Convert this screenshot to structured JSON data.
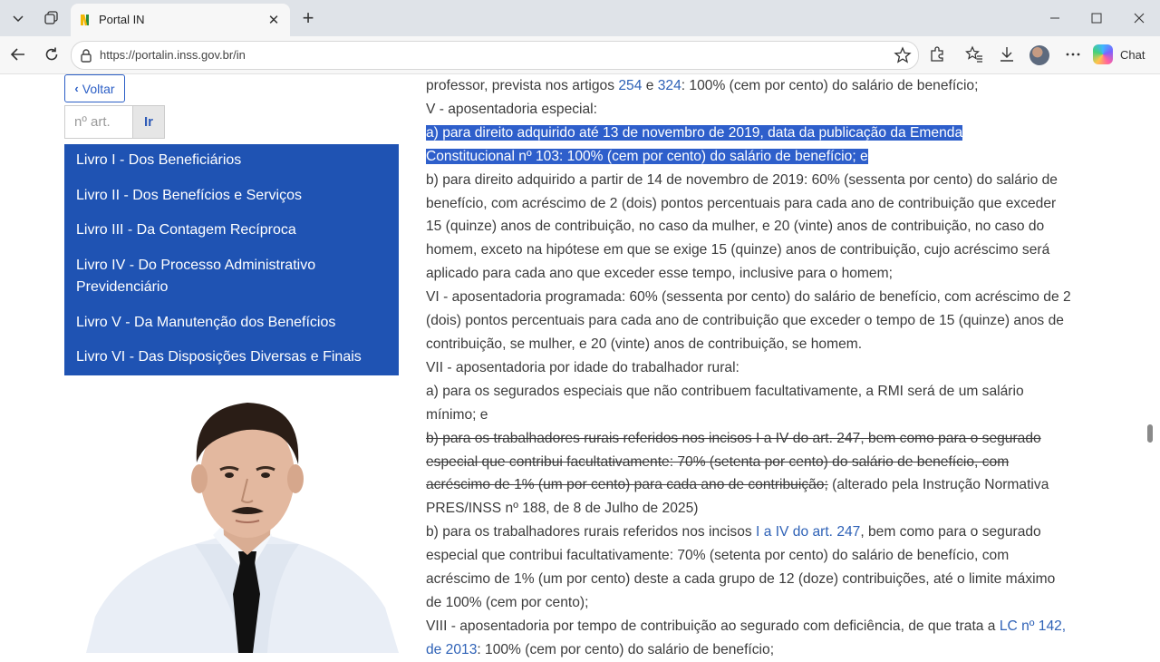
{
  "browser": {
    "tab_title": "Portal IN",
    "tab_close": "✕",
    "new_tab": "+",
    "url": "https://portalin.inss.gov.br/in",
    "chat_label": "Chat"
  },
  "sidebar": {
    "back_label": "Voltar",
    "article_placeholder": "nº art.",
    "go_label": "Ir",
    "books": [
      "Livro I - Dos Beneficiários",
      "Livro II - Dos Benefícios e Serviços",
      "Livro III - Da Contagem Recíproca",
      "Livro IV - Do Processo Administrativo Previdenciário",
      "Livro V - Da Manutenção dos Benefícios",
      "Livro VI - Das Disposições Diversas e Finais"
    ]
  },
  "content": {
    "p1_a": "professor, prevista nos artigos ",
    "p1_link1": "254",
    "p1_b": " e ",
    "p1_link2": "324",
    "p1_c": ": 100% (cem por cento) do salário de benefício;",
    "p2": "V - aposentadoria especial:",
    "p3_line1": "a) para direito adquirido até 13 de novembro de 2019, data da publicação da Emenda",
    "p3_line2": "Constitucional nº 103: 100% (cem por cento) do salário de benefício; e",
    "p4": "b) para direito adquirido a partir de 14 de novembro de 2019: 60% (sessenta por cento) do salário de benefício, com acréscimo de 2 (dois) pontos percentuais para cada ano de contribuição que exceder 15 (quinze) anos de contribuição, no caso da mulher, e 20 (vinte) anos de contribuição, no caso do homem, exceto na hipótese em que se exige 15 (quinze) anos de contribuição, cujo acréscimo será aplicado para cada ano que exceder esse tempo, inclusive para o homem;",
    "p5": "VI - aposentadoria programada: 60% (sessenta por cento) do salário de benefício, com acréscimo de 2 (dois) pontos percentuais para cada ano de contribuição que exceder o tempo de 15 (quinze) anos de contribuição, se mulher, e 20 (vinte) anos de contribuição, se homem.",
    "p6": "VII - aposentadoria por idade do trabalhador rural:",
    "p7": "a) para os segurados especiais que não contribuem facultativamente, a RMI será de um salário mínimo; e",
    "p8_struck": "b) para os trabalhadores rurais referidos nos incisos I a IV do art. 247, bem como para o segurado especial que contribui facultativamente: 70% (setenta por cento) do salário de benefício, com acréscimo de 1% (um por cento) para cada ano de contribuição;",
    "p8_note": " (alterado pela Instrução Normativa PRES/INSS nº 188, de 8 de Julho de 2025)",
    "p9_a": "b) para os trabalhadores rurais referidos nos incisos ",
    "p9_link": "I a IV do art. 247",
    "p9_b": ", bem como para o segurado especial que contribui facultativamente: 70% (setenta por cento) do salário de benefício, com acréscimo de 1% (um por cento) deste a cada grupo de 12 (doze) contribuições, até o limite máximo de 100% (cem por cento);",
    "p10_a": "VIII - aposentadoria por tempo de contribuição ao segurado com deficiência, de que trata a ",
    "p10_link": "LC nº 142, de 2013",
    "p10_b": ": 100% (cem por cento) do salário de benefício;"
  },
  "colors": {
    "sidebar_bg": "#1f53b3",
    "highlight_bg": "#2e5fcb",
    "link": "#2f62b7"
  }
}
